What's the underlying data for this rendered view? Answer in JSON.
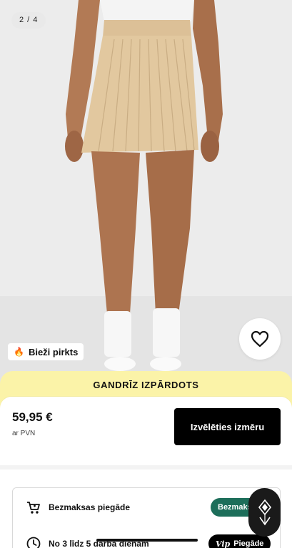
{
  "gallery": {
    "counter": "2 / 4"
  },
  "badge": {
    "icon": "fire-icon",
    "label": "Bieži pirkts"
  },
  "wishlist": {
    "icon": "heart-icon"
  },
  "banner": {
    "text": "GANDRĪZ IZPĀRDOTS",
    "color": "#fbf3a8"
  },
  "product": {
    "price": "59,95 €",
    "vat_note": "ar PVN"
  },
  "actions": {
    "select_size": "Izvēlēties izmēru"
  },
  "delivery": {
    "rows": [
      {
        "icon": "cart-icon",
        "label": "Bezmaksas piegāde",
        "pill": "Bezmaksas",
        "pill_color": "#1d6e5a"
      },
      {
        "icon": "clock-icon",
        "label": "No 3 līdz 5 darba dienām",
        "pill_prefix": "Vip",
        "pill": "Piegāde",
        "pill_color": "#000000"
      }
    ]
  },
  "assistant": {
    "icon": "assistant-logo-icon"
  }
}
